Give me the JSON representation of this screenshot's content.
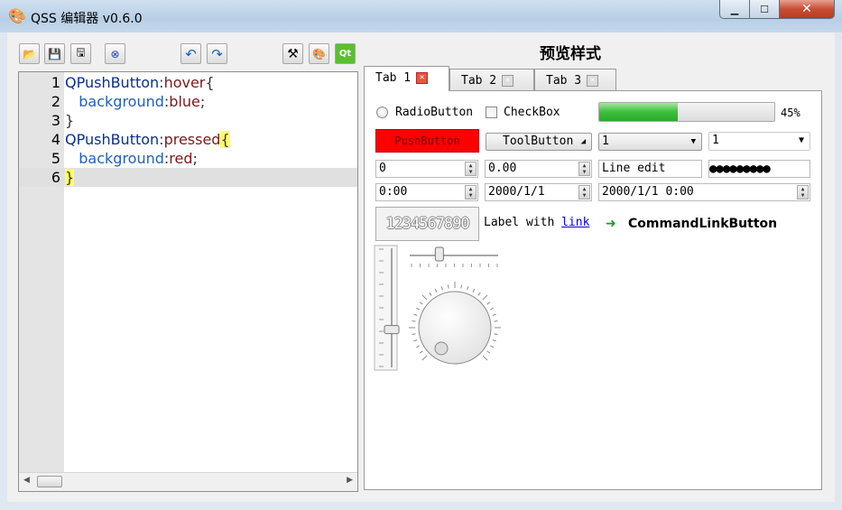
{
  "window": {
    "title": "QSS 编辑器 v0.6.0",
    "buttons": {
      "minimize": "▁",
      "maximize": "☐",
      "close": "✕"
    }
  },
  "toolbar": {
    "items": [
      {
        "name": "open-icon",
        "glyph": "📂"
      },
      {
        "name": "save-icon",
        "glyph": "💾"
      },
      {
        "name": "save-as-icon",
        "glyph": "🖫"
      },
      {
        "name": "close-file-icon",
        "glyph": "⊗"
      },
      {
        "name": "undo-icon",
        "glyph": "↶"
      },
      {
        "name": "redo-icon",
        "glyph": "↷"
      },
      {
        "name": "tools-icon",
        "glyph": "⚒"
      },
      {
        "name": "palette-icon",
        "glyph": "🎨"
      },
      {
        "name": "qt-icon",
        "glyph": "Qt"
      }
    ]
  },
  "editor": {
    "lines": [
      {
        "num": "1",
        "selector": "QPushButton",
        "colon": ":",
        "pseudo": "hover",
        "brace": "{"
      },
      {
        "num": "2",
        "prop": "background",
        "colon": ":",
        "val": "blue",
        "semi": ";"
      },
      {
        "num": "3",
        "brace": "}"
      },
      {
        "num": "4",
        "selector": "QPushButton",
        "colon": ":",
        "pseudo": "pressed",
        "brace": "{"
      },
      {
        "num": "5",
        "prop": "background",
        "colon": ":",
        "val": "red",
        "semi": ";"
      },
      {
        "num": "6",
        "brace": "}"
      }
    ]
  },
  "preview": {
    "title": "预览样式",
    "tabs": [
      {
        "label": "Tab 1"
      },
      {
        "label": "Tab 2"
      },
      {
        "label": "Tab 3"
      }
    ],
    "radio_label": "RadioButton",
    "checkbox_label": "CheckBox",
    "progress": {
      "value": 0.45,
      "text": "45%"
    },
    "push_button": "PushButton",
    "tool_button": "ToolButton",
    "combo1_value": "1",
    "combo2_value": "1",
    "spin_int": "0",
    "spin_double": "0.00",
    "line_edit": "Line edit",
    "password_dots": "●●●●●●●●●",
    "time_edit": "0:00",
    "date_edit": "2000/1/1",
    "datetime_edit": "2000/1/1 0:00",
    "lcd_value": "1234567890",
    "label_prefix": "Label with ",
    "label_link": "link",
    "command_link": "CommandLinkButton",
    "vslider_value": 0.3,
    "hslider_value": 0.33
  }
}
